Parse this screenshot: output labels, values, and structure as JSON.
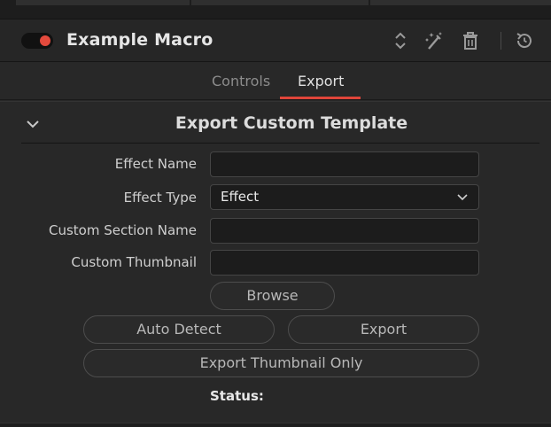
{
  "header": {
    "macro_title": "Example Macro",
    "toggle_color": "#e44a3d",
    "icons": [
      "up-down-arrows-icon",
      "magic-wand-icon",
      "trash-icon",
      "reset-icon"
    ]
  },
  "tabs": [
    {
      "label": "Controls",
      "active": false
    },
    {
      "label": "Export",
      "active": true
    }
  ],
  "section": {
    "title": "Export Custom Template",
    "fields": {
      "effect_name": {
        "label": "Effect Name",
        "value": ""
      },
      "effect_type": {
        "label": "Effect Type",
        "value": "Effect"
      },
      "custom_section_name": {
        "label": "Custom Section Name",
        "value": ""
      },
      "custom_thumbnail": {
        "label": "Custom Thumbnail",
        "value": ""
      }
    },
    "buttons": {
      "browse": "Browse",
      "auto_detect": "Auto Detect",
      "export": "Export",
      "export_thumbnail_only": "Export Thumbnail Only"
    },
    "status_label": "Status:"
  },
  "accent_color": "#e0453a"
}
